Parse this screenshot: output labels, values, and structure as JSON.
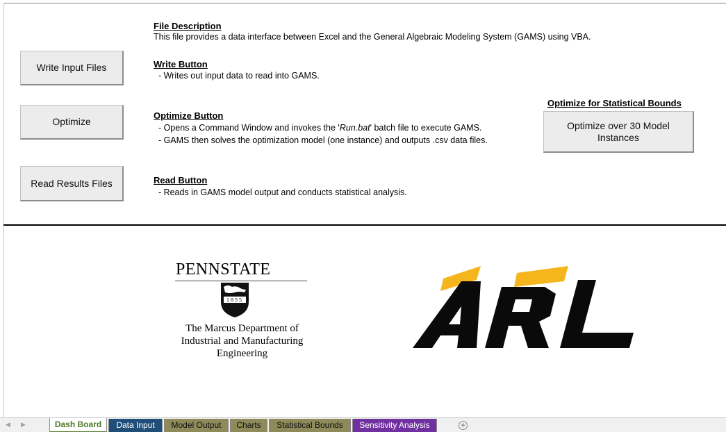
{
  "buttons": {
    "write_input": "Write Input Files",
    "optimize": "Optimize",
    "read_results": "Read Results Files",
    "optimize_30": "Optimize over 30 Model Instances"
  },
  "sections": {
    "file_description": {
      "heading": "File Description",
      "text": "This file provides a data interface between Excel and the General Algebraic Modeling System (GAMS) using VBA."
    },
    "write_button": {
      "heading": "Write Button",
      "text": "  - Writes out input data to read into GAMS."
    },
    "optimize_button": {
      "heading": "Optimize Button",
      "line1_pre": "  - Opens a Command Window and invokes the '",
      "line1_italic": "Run.bat",
      "line1_post": "' batch file to execute GAMS.",
      "line2": "  - GAMS then solves the optimization model (one instance) and outputs .csv data files."
    },
    "read_button": {
      "heading": "Read Button",
      "text": "  - Reads in GAMS model output and conducts statistical analysis."
    },
    "statistical_bounds": {
      "heading": "Optimize for Statistical Bounds"
    }
  },
  "logos": {
    "pennstate": {
      "wordmark": "PENNSTATE",
      "year": "1855",
      "dept_line1": "The Marcus Department of",
      "dept_line2": "Industrial and Manufacturing",
      "dept_line3": "Engineering"
    },
    "arl": {
      "wordmark": "ARL",
      "colors": {
        "yellow": "#f5b51d",
        "black": "#0a0a0a"
      }
    }
  },
  "sheet_tabs": [
    {
      "label": "Dash Board",
      "active": true,
      "color": "#ffffff"
    },
    {
      "label": "Data Input",
      "active": false,
      "color": "#1f4e79"
    },
    {
      "label": "Model Output",
      "active": false,
      "color": "#8e8a5a"
    },
    {
      "label": "Charts",
      "active": false,
      "color": "#8e8a5a"
    },
    {
      "label": "Statistical Bounds",
      "active": false,
      "color": "#8e8a5a"
    },
    {
      "label": "Sensitivity Analysis",
      "active": false,
      "color": "#7030a0"
    }
  ]
}
